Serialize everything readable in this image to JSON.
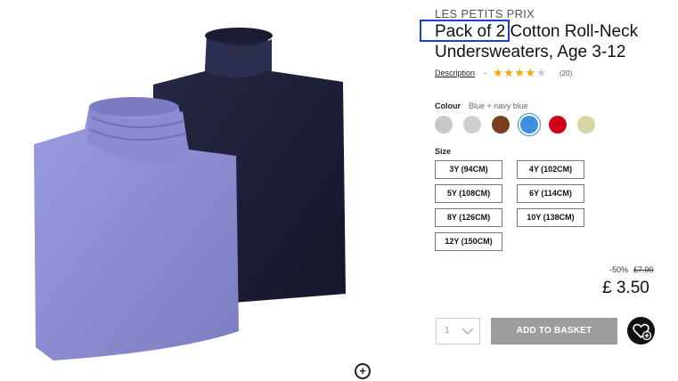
{
  "product": {
    "brand": "LES PETITS PRIX",
    "title_part1": "Pack of 2",
    "title_part2": "Cotton Roll-Neck Undersweaters, Age 3-12",
    "description_link": "Description",
    "separator": "-",
    "rating_stars": 4.5,
    "rating_count": "(20)"
  },
  "colour": {
    "label": "Colour",
    "selected": "Blue + navy blue",
    "swatches": [
      {
        "name": "light-grey",
        "color": "#c8c8c8"
      },
      {
        "name": "grey",
        "color": "#cfcfcf"
      },
      {
        "name": "brown",
        "color": "#7b3f1f"
      },
      {
        "name": "blue",
        "color": "#3f90dc",
        "selected": true
      },
      {
        "name": "red",
        "color": "#d0021b"
      },
      {
        "name": "beige",
        "color": "#d9d6a4"
      }
    ]
  },
  "size": {
    "label": "Size",
    "options": [
      "3Y (94CM)",
      "4Y (102CM)",
      "5Y (108CM)",
      "6Y (114CM)",
      "8Y (126CM)",
      "10Y (138CM)",
      "12Y (150CM)"
    ]
  },
  "pricing": {
    "discount": "-50%",
    "old_price": "£7.00",
    "price": "£ 3.50"
  },
  "basket": {
    "quantity": "1",
    "add_label": "ADD TO BASKET"
  },
  "icons": {
    "zoom": "zoom-plus-icon",
    "wishlist": "heart-plus-icon",
    "chevron": "chevron-down-icon",
    "star": "star-icon"
  },
  "colors": {
    "highlight": "#1a3fd6",
    "star": "#f2a900",
    "add_button": "#9d9d9d",
    "sweater_lavender": "#8f8fd1",
    "sweater_navy": "#1e1f3a"
  }
}
